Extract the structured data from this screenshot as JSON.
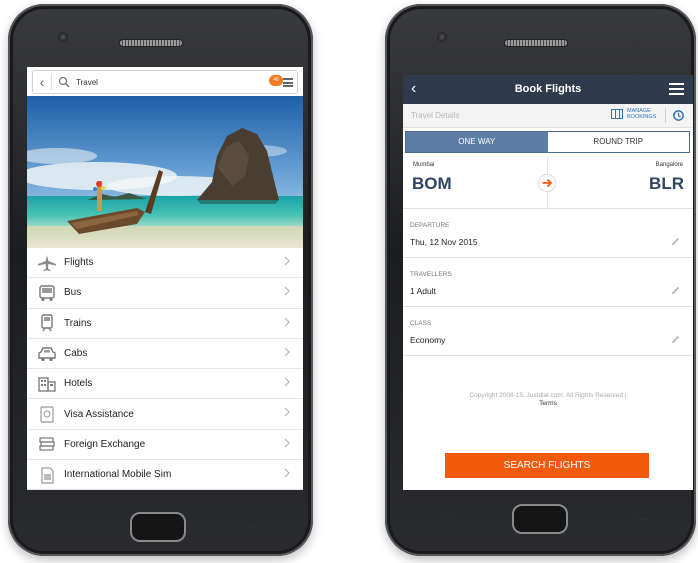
{
  "left_phone": {
    "search": {
      "text": "Travel",
      "badge": "48"
    },
    "menu_items": [
      {
        "label": "Flights",
        "icon": "plane-icon"
      },
      {
        "label": "Bus",
        "icon": "bus-icon"
      },
      {
        "label": "Trains",
        "icon": "train-icon"
      },
      {
        "label": "Cabs",
        "icon": "cab-icon"
      },
      {
        "label": "Hotels",
        "icon": "hotel-icon"
      },
      {
        "label": "Visa Assistance",
        "icon": "visa-icon"
      },
      {
        "label": "Foreign Exchange",
        "icon": "money-icon"
      },
      {
        "label": "International Mobile Sim",
        "icon": "sim-icon"
      }
    ]
  },
  "right_phone": {
    "header": {
      "title": "Book Flights"
    },
    "details": {
      "label": "Travel Details",
      "manage_bookings": "MANAGE BOOKINGS"
    },
    "tabs": {
      "one_way": "ONE WAY",
      "round_trip": "ROUND TRIP"
    },
    "route": {
      "from_city": "Mumbai",
      "from_code": "BOM",
      "to_city": "Bangalore",
      "to_code": "BLR"
    },
    "fields": {
      "departure_label": "DEPARTURE",
      "departure_value": "Thu, 12 Nov 2015",
      "travellers_label": "TRAVELLERS",
      "travellers_value": "1 Adult",
      "class_label": "CLASS",
      "class_value": "Economy"
    },
    "footer": {
      "copyright": "Copyright 2008-15, Justdial.com. All Rights Reserved |",
      "terms": "Terms"
    },
    "search_button": "SEARCH FLIGHTS"
  },
  "colors": {
    "accent_orange": "#f25a0e",
    "header_navy": "#2f3a4d",
    "tab_active": "#5c7ea6",
    "code_text": "#2f4563",
    "link_blue": "#2e73b8"
  }
}
